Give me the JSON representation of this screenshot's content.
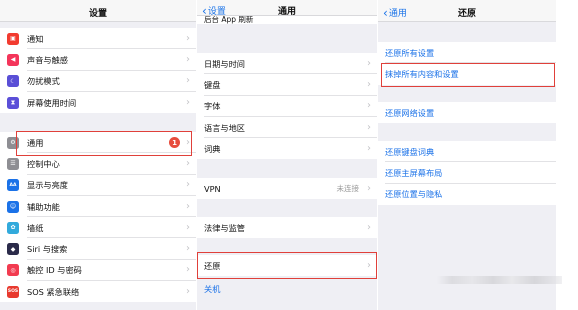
{
  "panel1": {
    "title": "设置",
    "group1": [
      {
        "label": "通知",
        "icon": "notifications-icon",
        "color": "#f23b30",
        "glyph": "▣"
      },
      {
        "label": "声音与触感",
        "icon": "sounds-icon",
        "color": "#f4355a",
        "glyph": "◀"
      },
      {
        "label": "勿扰模式",
        "icon": "do-not-disturb-icon",
        "color": "#5a4fd6",
        "glyph": "☾"
      },
      {
        "label": "屏幕使用时间",
        "icon": "screen-time-icon",
        "color": "#5b4fd8",
        "glyph": "⧗"
      }
    ],
    "group2": [
      {
        "label": "通用",
        "icon": "general-icon",
        "color": "#8e8e93",
        "glyph": "⚙",
        "badge": "1"
      },
      {
        "label": "控制中心",
        "icon": "control-center-icon",
        "color": "#8e8e93",
        "glyph": "☰"
      },
      {
        "label": "显示与亮度",
        "icon": "display-brightness-icon",
        "color": "#1b72e8",
        "glyph": "AA"
      },
      {
        "label": "辅助功能",
        "icon": "accessibility-icon",
        "color": "#1b72e8",
        "glyph": "☺"
      },
      {
        "label": "墙纸",
        "icon": "wallpaper-icon",
        "color": "#32aadc",
        "glyph": "✿"
      },
      {
        "label": "Siri 与搜索",
        "icon": "siri-icon",
        "color": "#2b2b4a",
        "glyph": "◆"
      },
      {
        "label": "触控 ID 与密码",
        "icon": "touch-id-icon",
        "color": "#f23b50",
        "glyph": "◎"
      },
      {
        "label": "SOS 紧急联络",
        "icon": "sos-icon",
        "color": "#e8392e",
        "glyph": "SOS"
      }
    ]
  },
  "panel2": {
    "back_label": "设置",
    "title": "通用",
    "top_row": "后台 App 刷新",
    "group1": [
      "日期与时间",
      "键盘",
      "字体",
      "语言与地区",
      "词典"
    ],
    "group2": [
      {
        "label": "VPN",
        "detail": "未连接"
      }
    ],
    "group3": [
      "法律与监管"
    ],
    "group4": [
      "还原"
    ],
    "shutdown": "关机"
  },
  "panel3": {
    "back_label": "通用",
    "title": "还原",
    "group1": [
      "还原所有设置",
      "抹掉所有内容和设置"
    ],
    "group2": [
      "还原网络设置"
    ],
    "group3": [
      "还原键盘词典",
      "还原主屏幕布局",
      "还原位置与隐私"
    ]
  },
  "highlight_color": "#e0403a",
  "link_color": "#1b72e8"
}
